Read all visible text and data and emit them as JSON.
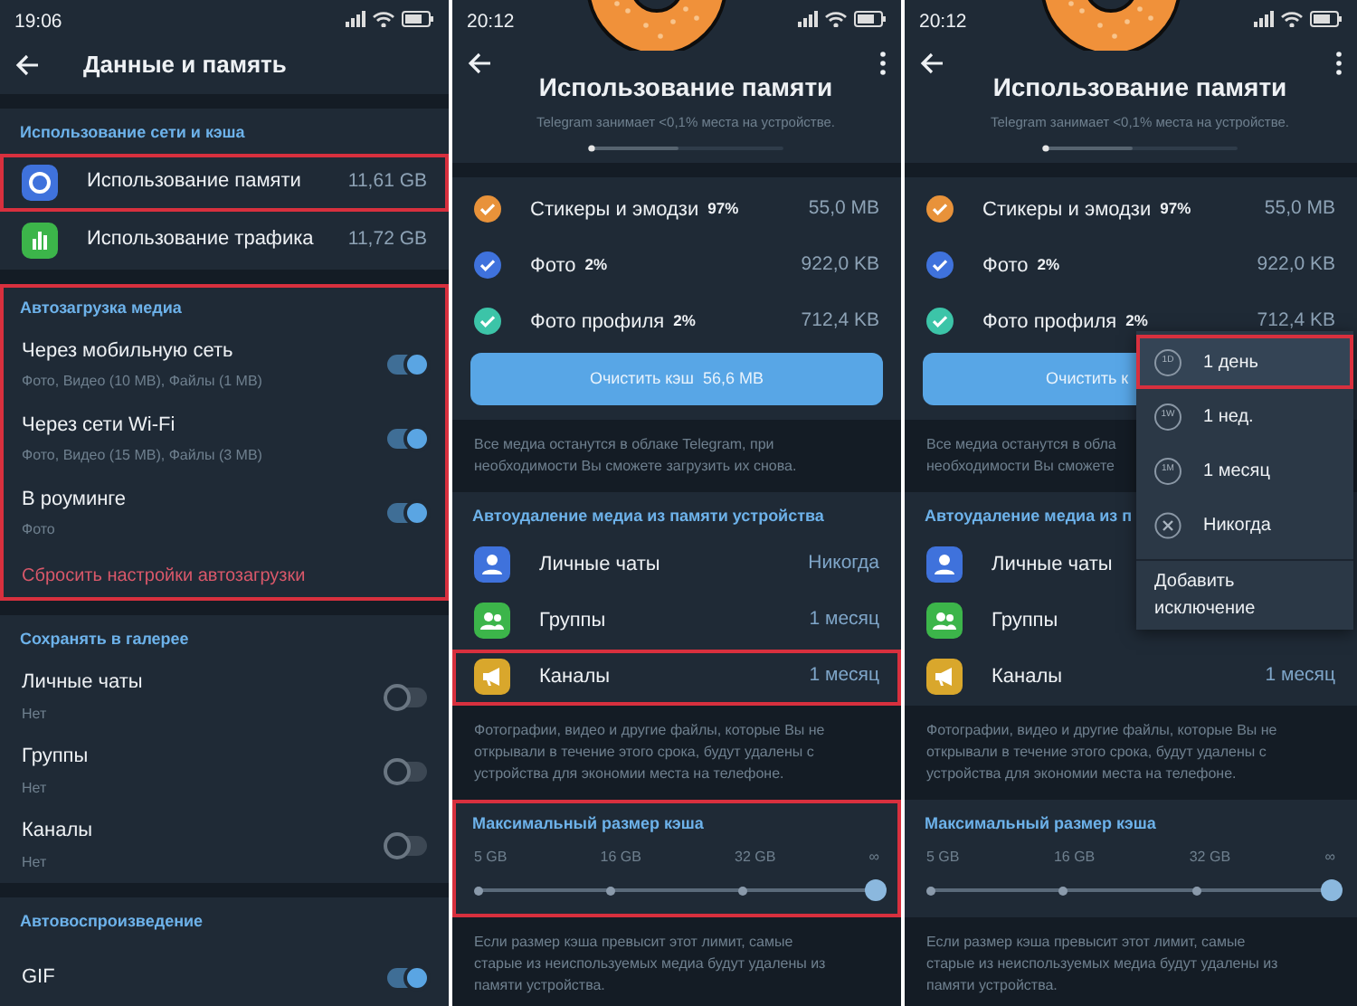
{
  "panels": [
    {
      "kind": "settings",
      "time": "19:06",
      "title": "Данные и память",
      "sections": [
        {
          "header": "Использование сети и кэша",
          "highlighted": false,
          "rows": [
            {
              "kind": "link",
              "color": "#3f72dc",
              "label": "Использование памяти",
              "value": "11,61 GB",
              "highlighted": true
            },
            {
              "kind": "link",
              "color": "#3cb54a",
              "label": "Использование трафика",
              "value": "11,72 GB",
              "highlighted": false
            }
          ]
        },
        {
          "header": "Автозагрузка медиа",
          "highlighted": true,
          "rows": [
            {
              "kind": "toggle",
              "label": "Через мобильную сеть",
              "sub": "Фото, Видео (10 MB), Файлы (1 MB)",
              "on": true
            },
            {
              "kind": "toggle",
              "label": "Через сети Wi-Fi",
              "sub": "Фото, Видео (15 MB), Файлы (3 MB)",
              "on": true
            },
            {
              "kind": "toggle",
              "label": "В роуминге",
              "sub": "Фото",
              "on": true
            },
            {
              "kind": "action",
              "label": "Сбросить настройки автозагрузки"
            }
          ]
        },
        {
          "header": "Сохранять в галерее",
          "highlighted": false,
          "rows": [
            {
              "kind": "toggle",
              "label": "Личные чаты",
              "sub": "Нет",
              "on": false
            },
            {
              "kind": "toggle",
              "label": "Группы",
              "sub": "Нет",
              "on": false
            },
            {
              "kind": "toggle",
              "label": "Каналы",
              "sub": "Нет",
              "on": false
            }
          ]
        },
        {
          "header": "Автовоспроизведение",
          "highlighted": false,
          "rows": [
            {
              "kind": "toggle",
              "label": "GIF",
              "on": true
            }
          ]
        }
      ]
    },
    {
      "kind": "storage",
      "time": "20:12",
      "title": "Использование памяти",
      "subtitle": "Telegram занимает <0,1% места на устройстве.",
      "categories": [
        {
          "label": "Стикеры и эмодзи",
          "percent": "97%",
          "size": "55,0 MB",
          "color": "#e8923a",
          "checked": true
        },
        {
          "label": "Фото",
          "percent": "2%",
          "size": "922,0 KB",
          "color": "#3f72dc",
          "checked": true
        },
        {
          "label": "Фото профиля",
          "percent": "2%",
          "size": "712,4 KB",
          "color": "#3cc4a8",
          "checked": true
        }
      ],
      "clear_button": "Очистить кэш  56,6 MB",
      "note": [
        "Все медиа останутся в облаке Telegram, при",
        "необходимости Вы сможете загрузить их снова."
      ],
      "autodelete": {
        "header": "Автоудаление медиа из памяти устройства",
        "rows": [
          {
            "kind": "person",
            "color": "#3f72dc",
            "label": "Личные чаты",
            "value": "Никогда",
            "highlighted": false
          },
          {
            "kind": "group",
            "color": "#3cb54a",
            "label": "Группы",
            "value": "1 месяц",
            "highlighted": false
          },
          {
            "kind": "megaphone",
            "color": "#d9a72c",
            "label": "Каналы",
            "value": "1 месяц",
            "highlighted": true
          }
        ]
      },
      "autodelete_note": [
        "Фотографии, видео и другие файлы, которые Вы не",
        "открывали в течение этого срока, будут удалены с",
        "устройства для экономии места на телефоне."
      ],
      "cache_limit": {
        "header": "Максимальный размер кэша",
        "ticks": [
          "5 GB",
          "16 GB",
          "32 GB",
          "∞"
        ],
        "level": 1,
        "highlighted": true
      },
      "limit_note": [
        "Если размер кэша превысит этот лимит, самые",
        "старые из неиспользуемых медиа будут удалены из",
        "памяти устройства."
      ]
    },
    {
      "kind": "storage",
      "time": "20:12",
      "title": "Использование памяти",
      "subtitle": "Telegram занимает <0,1% места на устройстве.",
      "categories": [
        {
          "label": "Стикеры и эмодзи",
          "percent": "97%",
          "size": "55,0 MB",
          "color": "#e8923a",
          "checked": true
        },
        {
          "label": "Фото",
          "percent": "2%",
          "size": "922,0 KB",
          "color": "#3f72dc",
          "checked": true
        },
        {
          "label": "Фото профиля",
          "percent": "2%",
          "size": "712,4 KB",
          "color": "#3cc4a8",
          "checked": true
        }
      ],
      "clear_button": "Очистить к",
      "note": [
        "Все медиа останутся в обла",
        "необходимости Вы сможете"
      ],
      "autodelete": {
        "header": "Автоудаление медиа из п",
        "rows": [
          {
            "kind": "person",
            "color": "#3f72dc",
            "label": "Личные чаты",
            "highlighted": false
          },
          {
            "kind": "group",
            "color": "#3cb54a",
            "label": "Группы",
            "highlighted": false
          },
          {
            "kind": "megaphone",
            "color": "#d9a72c",
            "label": "Каналы",
            "value": "1 месяц",
            "highlighted": false
          }
        ]
      },
      "autodelete_note": [
        "Фотографии, видео и другие файлы, которые Вы не",
        "открывали в течение этого срока, будут удалены с",
        "устройства для экономии места на телефоне."
      ],
      "cache_limit": {
        "header": "Максимальный размер кэша",
        "ticks": [
          "5 GB",
          "16 GB",
          "32 GB",
          "∞"
        ],
        "level": 1,
        "highlighted": false
      },
      "limit_note": [
        "Если размер кэша превысит этот лимит, самые",
        "старые из неиспользуемых медиа будут удалены из",
        "памяти устройства."
      ],
      "menu": {
        "items": [
          {
            "kind": "timer",
            "badge": "1D",
            "label": "1 день",
            "highlighted": true
          },
          {
            "kind": "timer",
            "badge": "1W",
            "label": "1 нед.",
            "highlighted": false
          },
          {
            "kind": "timer",
            "badge": "1M",
            "label": "1 месяц",
            "highlighted": false
          },
          {
            "kind": "never",
            "label": "Никогда",
            "highlighted": false
          },
          {
            "kind": "action",
            "label": "Добавить исключение",
            "highlighted": false
          }
        ]
      }
    }
  ]
}
